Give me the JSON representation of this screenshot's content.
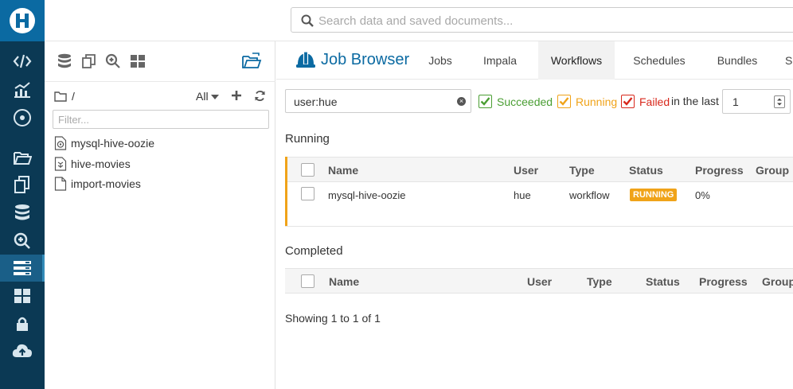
{
  "nav": {
    "logo": "hue-logo",
    "items": [
      {
        "icon": "code-icon"
      },
      {
        "icon": "chart-icon"
      },
      {
        "icon": "circle-dot-icon"
      },
      {
        "icon": "folder-open-icon"
      },
      {
        "icon": "documents-icon"
      },
      {
        "icon": "database-icon"
      },
      {
        "icon": "search-zoom-icon"
      },
      {
        "icon": "server-icon",
        "active": true
      },
      {
        "icon": "grid-icon"
      },
      {
        "icon": "lock-icon"
      },
      {
        "icon": "cloud-upload-icon"
      }
    ],
    "colors": {
      "bg": "#0b3954",
      "logo_bg": "#0b6aa2",
      "active": "#1a5f88"
    }
  },
  "top_search": {
    "placeholder": "Search data and saved documents..."
  },
  "assist": {
    "path": "/",
    "scope": "All",
    "filter_placeholder": "Filter...",
    "files": [
      {
        "name": "mysql-hive-oozie",
        "icon": "workflow-file-icon"
      },
      {
        "name": "hive-movies",
        "icon": "hive-file-icon"
      },
      {
        "name": "import-movies",
        "icon": "file-icon"
      }
    ]
  },
  "job_browser": {
    "title": "Job Browser",
    "tabs": [
      "Jobs",
      "Impala",
      "Workflows",
      "Schedules",
      "Bundles",
      "S"
    ],
    "active_tab": "Workflows",
    "user_filter": "user:hue",
    "status_filters": {
      "succeeded": "Succeeded",
      "running": "Running",
      "failed": "Failed"
    },
    "in_the_last_label": "in the last",
    "in_the_last_value": "1",
    "running_section": {
      "title": "Running",
      "columns": [
        "Name",
        "User",
        "Type",
        "Status",
        "Progress",
        "Group"
      ],
      "rows": [
        {
          "name": "mysql-hive-oozie",
          "user": "hue",
          "type": "workflow",
          "status": "RUNNING",
          "progress": "0%",
          "group": ""
        }
      ]
    },
    "completed_section": {
      "title": "Completed",
      "columns": [
        "Name",
        "User",
        "Type",
        "Status",
        "Progress",
        "Group"
      ]
    },
    "footer": "Showing 1 to 1 of 1",
    "colors": {
      "accent": "#0b6aa2",
      "running_badge": "#f0a319",
      "succeeded": "#4a9e33",
      "running": "#f0a319",
      "failed": "#d8281c"
    }
  }
}
